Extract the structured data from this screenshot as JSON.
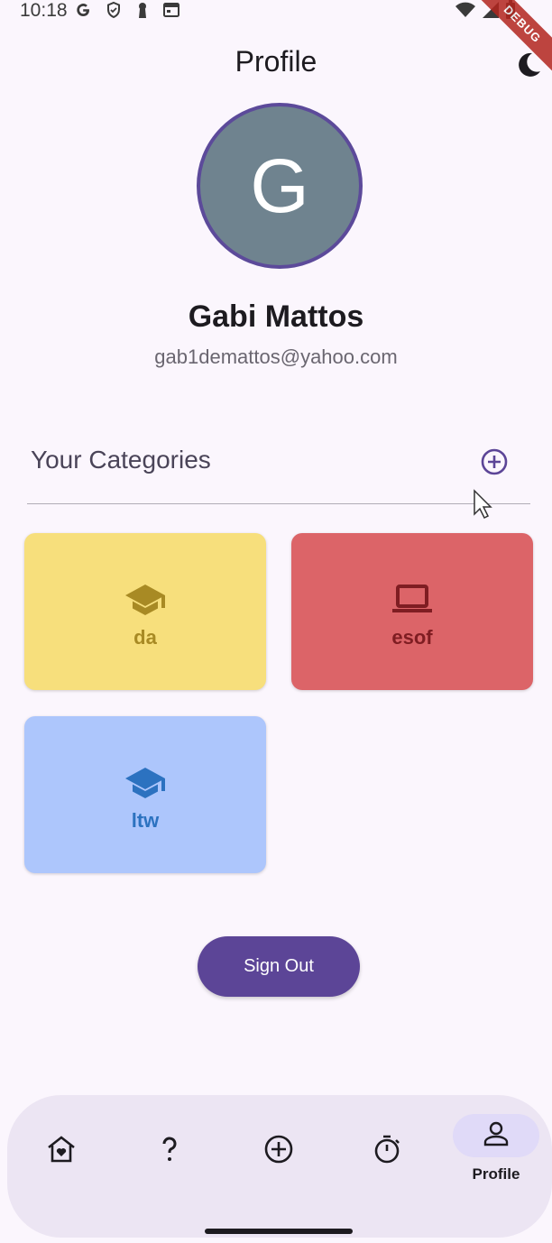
{
  "status_bar": {
    "time": "10:18",
    "icons_left": [
      "google-icon",
      "shield-icon",
      "keyhole-icon",
      "calendar-icon"
    ],
    "icons_right": [
      "wifi-icon",
      "signal-icon",
      "battery-icon"
    ]
  },
  "debug_banner": "DEBUG",
  "header": {
    "title": "Profile",
    "theme_toggle_icon": "moon-icon"
  },
  "profile": {
    "avatar_initial": "G",
    "avatar_color": "#6f838f",
    "name": "Gabi Mattos",
    "email": "gab1demattos@yahoo.com"
  },
  "categories": {
    "title": "Your Categories",
    "add_icon": "add-circle-icon",
    "items": [
      {
        "label": "da",
        "icon": "school-icon",
        "bg": "#f7df7c",
        "fg": "#a88a24"
      },
      {
        "label": "esof",
        "icon": "laptop-icon",
        "bg": "#dc6468",
        "fg": "#7f1d22"
      },
      {
        "label": "ltw",
        "icon": "school-icon",
        "bg": "#adc6fc",
        "fg": "#2c72c0"
      }
    ]
  },
  "sign_out_label": "Sign Out",
  "bottom_nav": {
    "items": [
      {
        "icon": "home-heart-icon"
      },
      {
        "icon": "question-icon"
      },
      {
        "icon": "add-circle-icon"
      },
      {
        "icon": "timer-icon"
      },
      {
        "icon": "person-icon",
        "label": "Profile",
        "selected": true
      }
    ]
  },
  "colors": {
    "primary": "#5c4597",
    "background": "#fbf6fd",
    "nav_background": "#ece5f3",
    "nav_selected": "#e0daf8"
  }
}
